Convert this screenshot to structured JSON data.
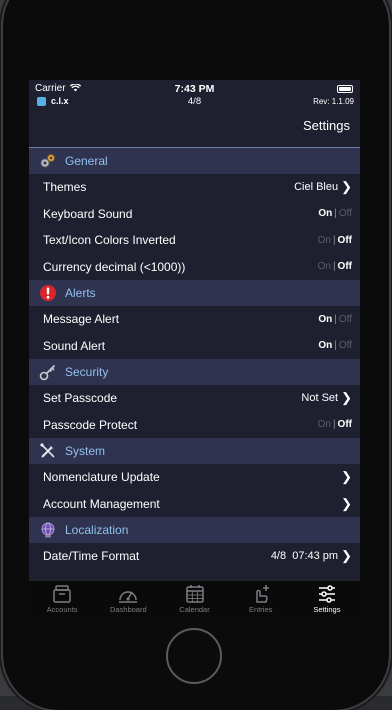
{
  "status_bar": {
    "carrier": "Carrier",
    "time": "7:43 PM",
    "app_name": "c.l.x",
    "page_indicator": "4/8",
    "revision": "Rev: 1.1.09"
  },
  "nav": {
    "title": "Settings"
  },
  "sections": {
    "general": {
      "title": "General",
      "themes": {
        "label": "Themes",
        "value": "Ciel Bleu"
      },
      "keyboard_sound": {
        "label": "Keyboard Sound",
        "on": "On",
        "off": "Off",
        "state": "on"
      },
      "text_icon_inverted": {
        "label": "Text/Icon Colors Inverted",
        "on": "On",
        "off": "Off",
        "state": "off"
      },
      "currency_decimal": {
        "label": "Currency decimal (<1000))",
        "on": "On",
        "off": "Off",
        "state": "off"
      }
    },
    "alerts": {
      "title": "Alerts",
      "message_alert": {
        "label": "Message Alert",
        "on": "On",
        "off": "Off",
        "state": "on"
      },
      "sound_alert": {
        "label": "Sound Alert",
        "on": "On",
        "off": "Off",
        "state": "on"
      }
    },
    "security": {
      "title": "Security",
      "set_passcode": {
        "label": "Set Passcode",
        "value": "Not Set"
      },
      "passcode_protect": {
        "label": "Passcode Protect",
        "on": "On",
        "off": "Off",
        "state": "off"
      }
    },
    "system": {
      "title": "System",
      "nomenclature_update": {
        "label": "Nomenclature Update"
      },
      "account_management": {
        "label": "Account Management"
      }
    },
    "localization": {
      "title": "Localization",
      "date_time_format": {
        "label": "Date/Time Format",
        "value": "4/8  07:43 pm"
      }
    }
  },
  "tabs": [
    {
      "label": "Accounts",
      "icon": "accounts-icon"
    },
    {
      "label": "Dashboard",
      "icon": "dashboard-icon"
    },
    {
      "label": "Calendar",
      "icon": "calendar-icon"
    },
    {
      "label": "Entries",
      "icon": "entries-icon"
    },
    {
      "label": "Settings",
      "icon": "settings-icon",
      "active": true
    }
  ],
  "background_fragments": {
    "left": "e",
    "right_top": "4.",
    "right_bottom": "/"
  },
  "colors": {
    "section_bg": "#303350",
    "row_bg": "#1e2030",
    "section_title": "#8fc1ee",
    "tabbar_bg": "#0a0a0b"
  }
}
